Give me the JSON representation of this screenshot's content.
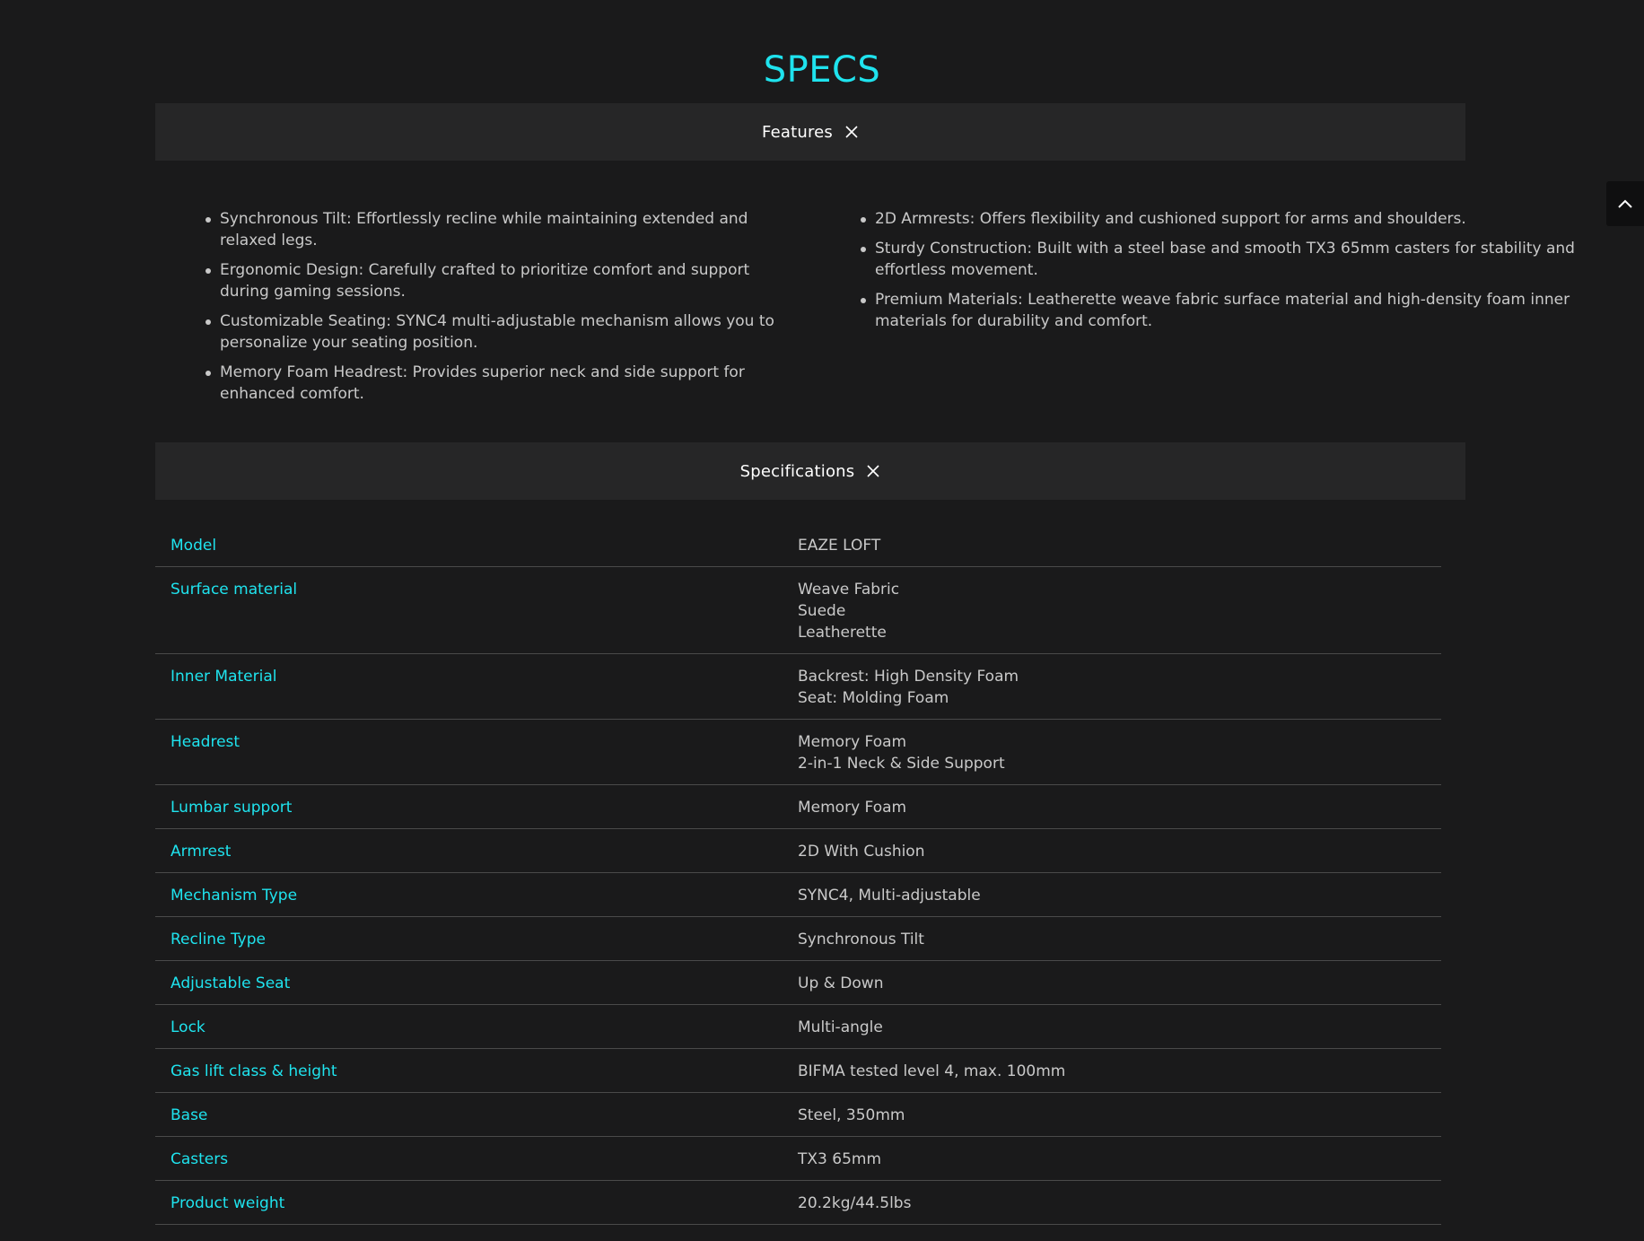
{
  "page_title": "SPECS",
  "features": {
    "header_label": "Features",
    "left": [
      "Synchronous Tilt: Effortlessly recline while maintaining extended and relaxed legs.",
      "Ergonomic Design: Carefully crafted to prioritize comfort and support during gaming sessions.",
      "Customizable Seating: SYNC4 multi-adjustable mechanism allows you to personalize your seating position.",
      "Memory Foam Headrest: Provides superior neck and side support for enhanced comfort."
    ],
    "right": [
      "2D Armrests: Offers flexibility and cushioned support for arms and shoulders.",
      "Sturdy Construction: Built with a steel base and smooth TX3 65mm casters for stability and effortless movement.",
      "Premium Materials: Leatherette weave fabric surface material and high-density foam inner materials for durability and comfort."
    ]
  },
  "specifications": {
    "header_label": "Specifications",
    "rows": [
      {
        "key": "Model",
        "values": [
          "EAZE LOFT"
        ]
      },
      {
        "key": "Surface material",
        "values": [
          "Weave Fabric",
          "Suede",
          "Leatherette"
        ]
      },
      {
        "key": "Inner Material",
        "values": [
          "Backrest: High Density Foam",
          "Seat: Molding Foam"
        ]
      },
      {
        "key": "Headrest",
        "values": [
          "Memory Foam",
          "2-in-1 Neck & Side Support"
        ]
      },
      {
        "key": "Lumbar support",
        "values": [
          "Memory Foam"
        ]
      },
      {
        "key": "Armrest",
        "values": [
          "2D With Cushion"
        ]
      },
      {
        "key": "Mechanism Type",
        "values": [
          "SYNC4, Multi-adjustable"
        ]
      },
      {
        "key": "Recline Type",
        "values": [
          "Synchronous Tilt"
        ]
      },
      {
        "key": "Adjustable Seat",
        "values": [
          "Up & Down"
        ]
      },
      {
        "key": "Lock",
        "values": [
          "Multi-angle"
        ]
      },
      {
        "key": "Gas lift class & height",
        "values": [
          "BIFMA tested level 4, max. 100mm"
        ]
      },
      {
        "key": "Base",
        "values": [
          "Steel, 350mm"
        ]
      },
      {
        "key": "Casters",
        "values": [
          "TX3 65mm"
        ]
      },
      {
        "key": "Product weight",
        "values": [
          "20.2kg/44.5lbs"
        ]
      }
    ]
  },
  "colors": {
    "accent": "#1fe3ee",
    "background": "#1a1a1b",
    "header_bg": "#262627"
  },
  "icons": {
    "collapse": "close-icon",
    "back_to_top": "chevron-up-icon"
  }
}
